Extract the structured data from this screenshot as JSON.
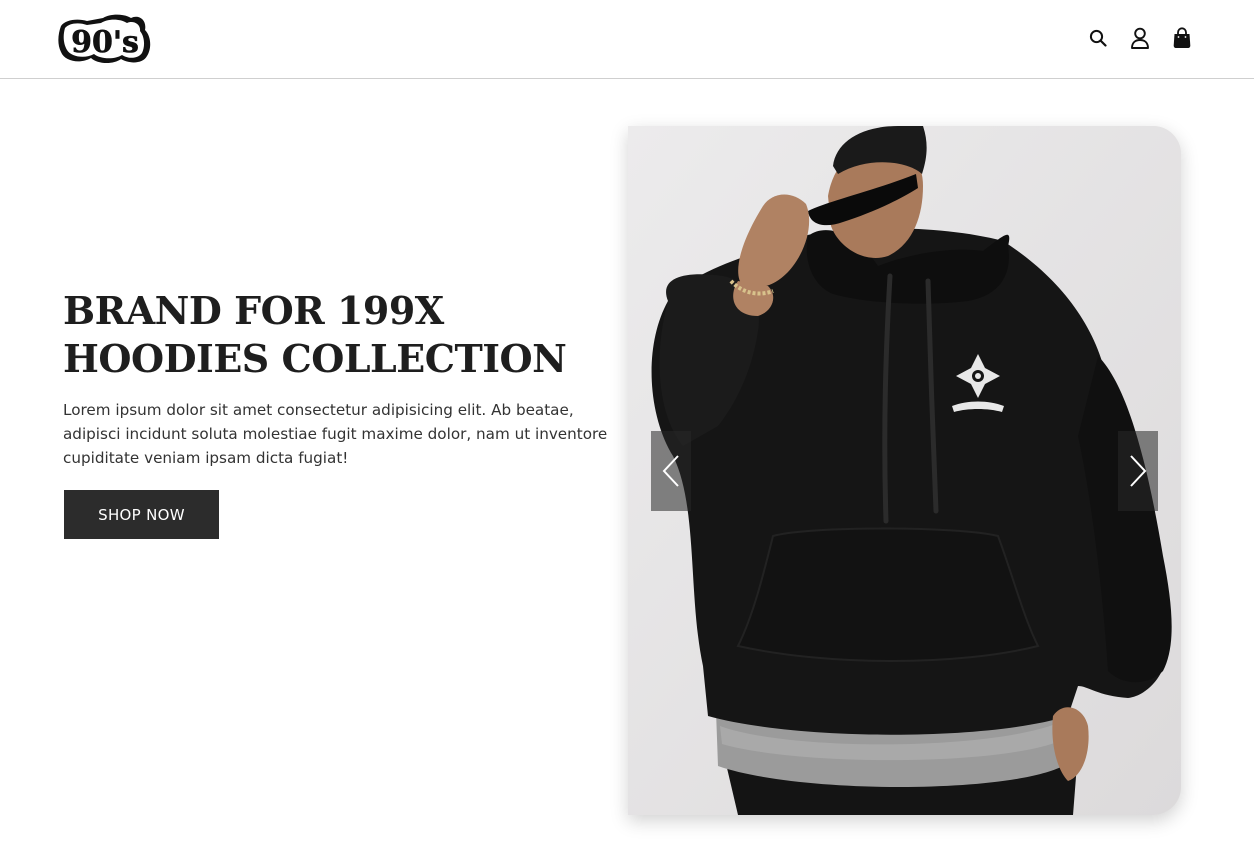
{
  "header": {
    "logo_text": "90's",
    "icons": [
      "search-icon",
      "user-icon",
      "shopping-bag-icon"
    ]
  },
  "hero": {
    "title_line1": "BRAND FOR 199X",
    "title_line2": "HOODIES COLLECTION",
    "description": "Lorem ipsum dolor sit amet consectetur adipisicing elit. Ab beatae, adipisci incidunt soluta molestiae fugit maxime dolor, nam ut inventore cupiditate veniam ipsam dicta fugiat!",
    "cta_label": "SHOP NOW"
  },
  "carousel": {
    "image_subject": "person wearing black hoodie and sunglasses",
    "prev_icon": "chevron-left-icon",
    "next_icon": "chevron-right-icon"
  },
  "colors": {
    "button_bg": "#2c2c2c",
    "text_dark": "#1e1e1e",
    "header_border": "#cfcfcf"
  }
}
